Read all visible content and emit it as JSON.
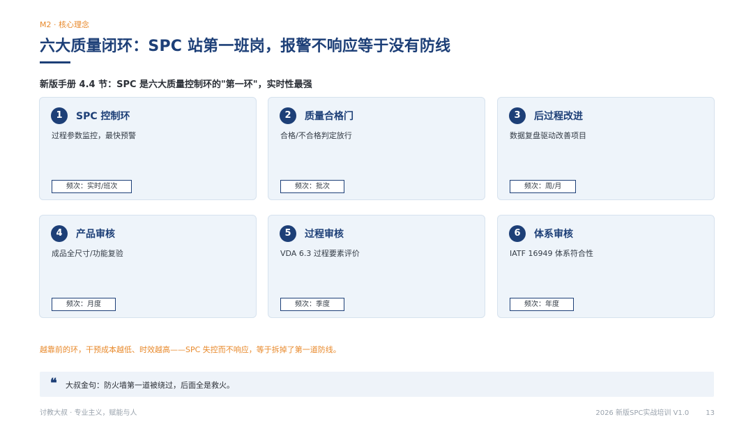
{
  "header": {
    "kicker": "M2 · 核心理念",
    "title": "六大质量闭环：SPC 站第一班岗，报警不响应等于没有防线",
    "subtitle": "新版手册 4.4 节：SPC 是六大质量控制环的\"第一环\"，实时性最强"
  },
  "cards": [
    {
      "num": "1",
      "title": "SPC 控制环",
      "desc": "过程参数监控，最快预警",
      "freq": "频次：实时/班次"
    },
    {
      "num": "2",
      "title": "质量合格门",
      "desc": "合格/不合格判定放行",
      "freq": "频次：批次"
    },
    {
      "num": "3",
      "title": "后过程改进",
      "desc": "数据复盘驱动改善项目",
      "freq": "频次：周/月"
    },
    {
      "num": "4",
      "title": "产品审核",
      "desc": "成品全尺寸/功能复验",
      "freq": "频次：月度"
    },
    {
      "num": "5",
      "title": "过程审核",
      "desc": "VDA 6.3 过程要素评价",
      "freq": "频次：季度"
    },
    {
      "num": "6",
      "title": "体系审核",
      "desc": "IATF 16949 体系符合性",
      "freq": "频次：年度"
    }
  ],
  "note": "越靠前的环，干预成本越低、时效越高——SPC 失控而不响应，等于拆掉了第一道防线。",
  "quote": {
    "icon": "quote-mark",
    "text": "大叔金句：防火墙第一道被绕过，后面全是救火。"
  },
  "footer": {
    "left": "讨教大叔 · 专业主义，赋能与人",
    "right": "2026 新版SPC实战培训 V1.0",
    "page": "13"
  },
  "colors": {
    "primary": "#1d3f77",
    "accent": "#e8892b",
    "card_bg": "#eef4fa"
  }
}
